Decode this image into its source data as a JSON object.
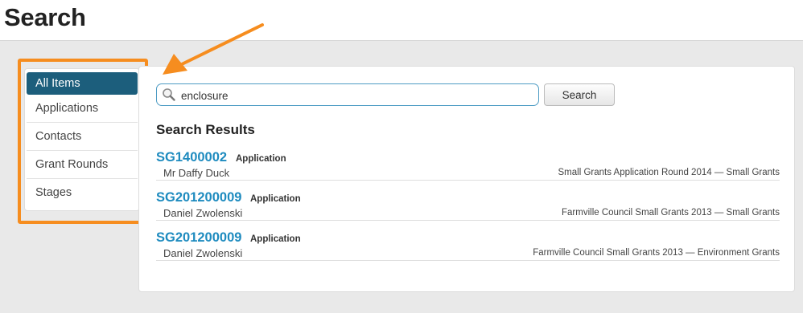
{
  "header": {
    "title": "Search"
  },
  "sidebar": {
    "items": [
      {
        "label": "All Items",
        "active": true
      },
      {
        "label": "Applications"
      },
      {
        "label": "Contacts"
      },
      {
        "label": "Grant Rounds"
      },
      {
        "label": "Stages"
      }
    ]
  },
  "search": {
    "value": "enclosure",
    "button_label": "Search"
  },
  "results": {
    "title": "Search Results",
    "items": [
      {
        "id": "SG1400002",
        "type": "Application",
        "name": "Mr Daffy Duck",
        "round": "Small Grants Application Round 2014 — Small Grants"
      },
      {
        "id": "SG201200009",
        "type": "Application",
        "name": "Daniel Zwolenski",
        "round": "Farmville Council Small Grants 2013 — Small Grants"
      },
      {
        "id": "SG201200009",
        "type": "Application",
        "name": "Daniel Zwolenski",
        "round": "Farmville Council Small Grants 2013 — Environment Grants"
      }
    ]
  },
  "colors": {
    "accent": "#1c5e7c",
    "link": "#1e8bbf",
    "highlight": "#f68d1f"
  },
  "icons": {
    "search": "magnifier-icon",
    "annotation": "arrow-icon"
  }
}
